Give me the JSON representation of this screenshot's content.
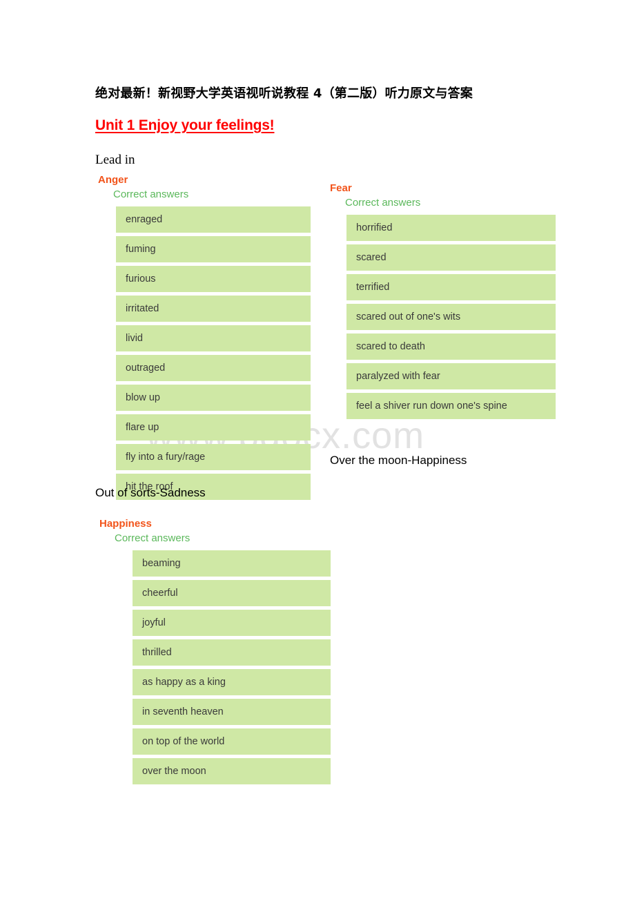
{
  "document": {
    "title": "绝对最新！新视野大学英语视听说教程 4（第二版）听力原文与答案",
    "unit_heading": "Unit 1    Enjoy your feelings!",
    "lead_in": "Lead in",
    "watermark": "www.bdocx.com"
  },
  "notes": {
    "over_the_moon": "Over the moon-Happiness",
    "out_of_sorts": "Out of sorts-Sadness"
  },
  "panels": [
    {
      "id": "anger",
      "title": "Anger",
      "subtitle": "Correct answers",
      "items": [
        "enraged",
        "fuming",
        "furious",
        "irritated",
        "livid",
        "outraged",
        "blow up",
        "flare up",
        "fly into a fury/rage",
        "hit the roof"
      ]
    },
    {
      "id": "fear",
      "title": "Fear",
      "subtitle": "Correct answers",
      "items": [
        "horrified",
        "scared",
        "terrified",
        "scared out of one's wits",
        "scared to death",
        "paralyzed with fear",
        "feel a shiver run down one's spine"
      ]
    },
    {
      "id": "happiness",
      "title": "Happiness",
      "subtitle": "Correct answers",
      "items": [
        "beaming",
        "cheerful",
        "joyful",
        "thrilled",
        "as happy as a king",
        "in seventh heaven",
        "on top of the world",
        "over the moon"
      ]
    }
  ],
  "colors": {
    "unit_heading": "#ff0000",
    "panel_title": "#f2541b",
    "panel_subtitle": "#5bb85b",
    "answer_bar": "#cfe8a5",
    "answer_text": "#3a3a3a",
    "watermark": "#e2e2e2"
  }
}
